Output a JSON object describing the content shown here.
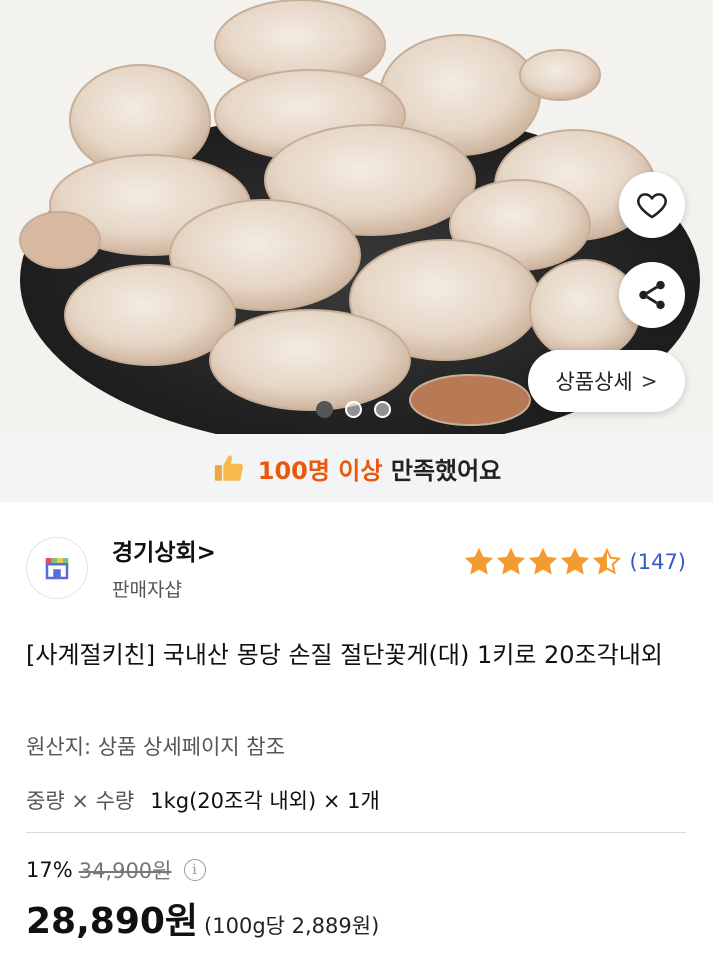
{
  "hero": {
    "favorite_icon": "heart-outline-icon",
    "share_icon": "share-icon",
    "detail_label": "상품상세",
    "detail_chevron": ">",
    "slide_dots": 3,
    "active_slide": 1
  },
  "satisfaction": {
    "icon": "thumbs-up-icon",
    "count_text": "100명 이상",
    "rest_text": "만족했어요"
  },
  "seller": {
    "name": "경기상회>",
    "subtitle": "판매자샵",
    "rating_value": 4.5,
    "rating_max": 5,
    "review_count": "(147)"
  },
  "product": {
    "title": "[사계절키친] 국내산 몽당 손질 절단꽃게(대) 1키로 20조각내외",
    "origin": "원산지: 상품 상세페이지 참조",
    "option_label": "중량 × 수량",
    "option_value": "1kg(20조각 내외) × 1개"
  },
  "pricing": {
    "discount_pct": "17%",
    "original_price": "34,900원",
    "info_icon": "i",
    "price": "28,890원",
    "unit_price": "(100g당 2,889원)"
  },
  "colors": {
    "accent_orange": "#e8590c",
    "star": "#f59a2f",
    "review_link": "#3559c7"
  }
}
